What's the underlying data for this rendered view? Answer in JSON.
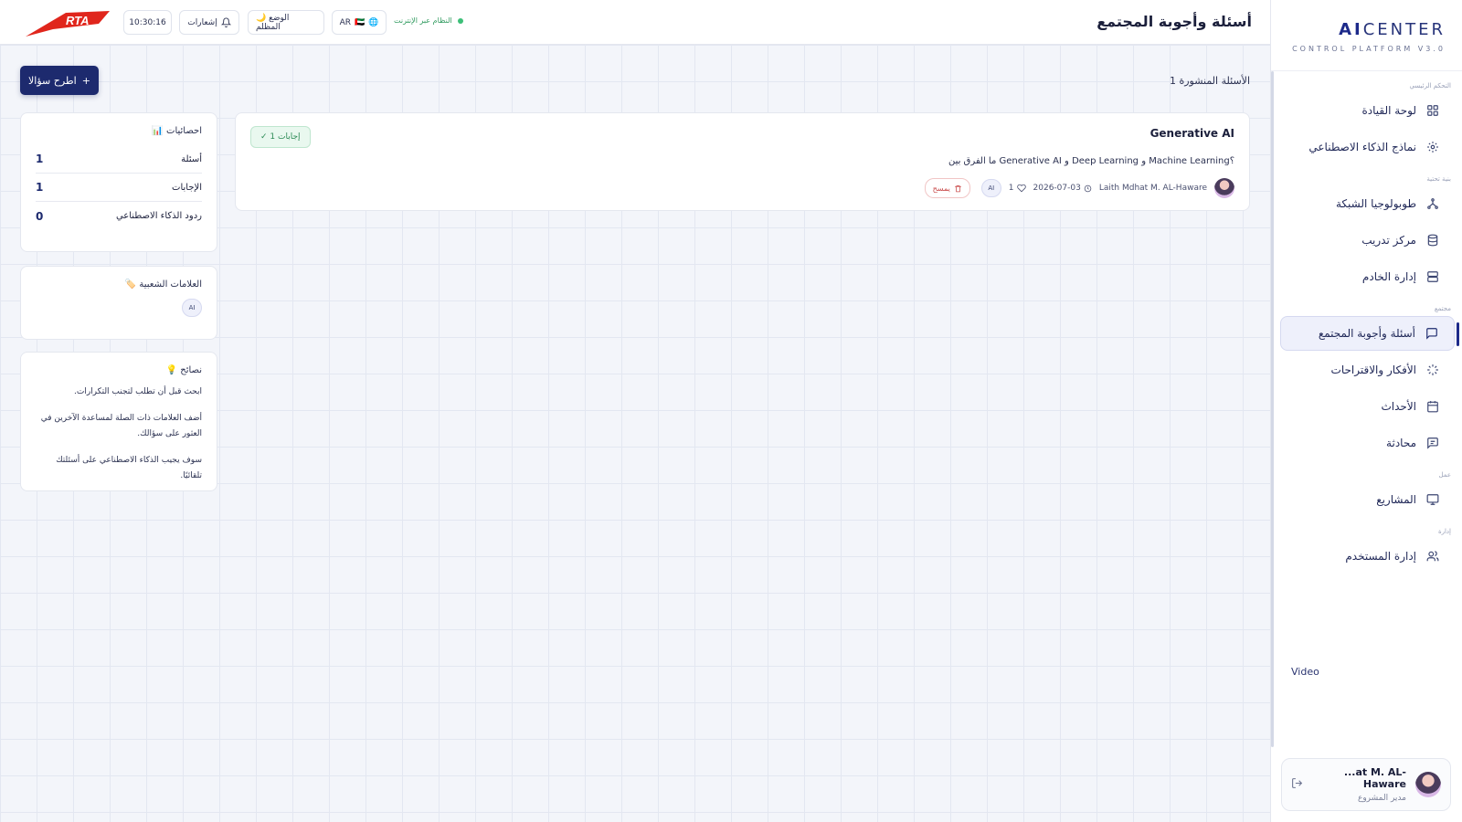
{
  "header": {
    "page_title": "أسئلة وأجوبة المجتمع",
    "status_text": "النظام عبر الإنترنت",
    "language": {
      "code": "AR",
      "flag": "🇦🇪",
      "globe": "🌐"
    },
    "theme_toggle": "🌙 الوضع المظلم",
    "notifications": "إشعارات",
    "clock": "10:30:16",
    "logo_text": "RTA"
  },
  "sidebar": {
    "brand": {
      "strong": "AI",
      "rest": "CENTER",
      "subtitle": "CONTROL PLATFORM V3.0"
    },
    "sections": {
      "main": "التحكم الرئيسي",
      "infra": "بنية تحتية",
      "community": "مجتمع",
      "work": "عمل",
      "admin": "إدارة"
    },
    "items": {
      "dashboard": "لوحة القيادة",
      "ai_models": "نماذج الذكاء الاصطناعي",
      "topology": "طوبولوجيا الشبكة",
      "training": "مركز تدريب",
      "servers": "إدارة الخادم",
      "qa": "أسئلة وأجوبة المجتمع",
      "ideas": "الأفكار والاقتراحات",
      "events": "الأحداث",
      "chat": "محادثة",
      "projects": "المشاريع",
      "users": "إدارة المستخدم"
    },
    "video": "Video",
    "user": {
      "name": "...at M. AL-Haware",
      "role": "مدير المشروع"
    }
  },
  "main": {
    "ask_button": "اطرح سؤالا",
    "published_count": "1 الأسئلة المنشورة",
    "question": {
      "title": "Generative AI",
      "body": "ما الفرق بين Generative AI و Deep Learning و Machine Learning؟",
      "answers_badge": "✓ 1 إجابات",
      "author": "Laith Mdhat M. AL-Haware",
      "date": "2026-07-03",
      "likes": "1",
      "tag": "AI",
      "delete_label": "يمسح"
    },
    "stats": {
      "title": "📊 احصائيات",
      "rows": [
        {
          "label": "أسئلة",
          "value": "1"
        },
        {
          "label": "الإجابات",
          "value": "1"
        },
        {
          "label": "ردود الذكاء الاصطناعي",
          "value": "0"
        }
      ]
    },
    "popular_tags": {
      "title": "🏷️ العلامات الشعبية",
      "tag": "AI"
    },
    "tips": {
      "title": "💡 نصائح",
      "items": [
        "ابحث قبل أن تطلب لتجنب التكرارات.",
        "أضف العلامات ذات الصلة لمساعدة الآخرين في العثور على سؤالك.",
        "سوف يجيب الذكاء الاصطناعي على أسئلتك تلقائيًا."
      ]
    }
  }
}
